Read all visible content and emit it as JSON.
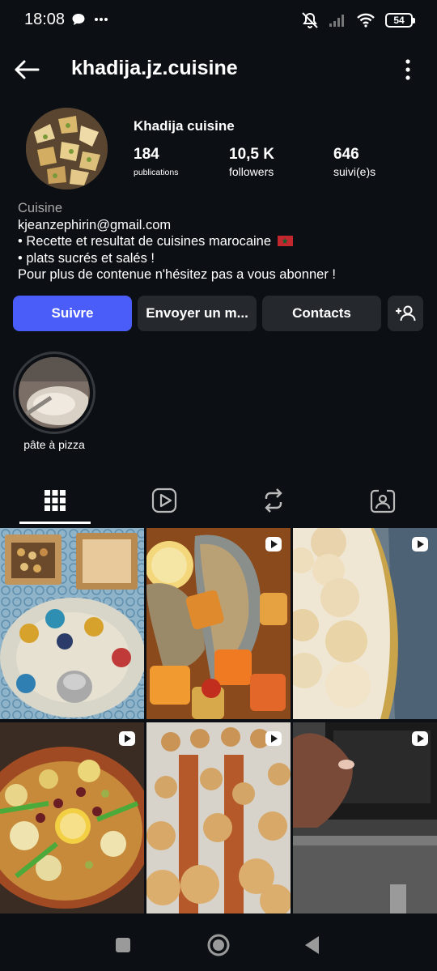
{
  "status_bar": {
    "time": "18:08",
    "battery": "54",
    "icons": [
      "chat-bubble-icon",
      "more-dots-icon",
      "mute-icon",
      "signal-icon",
      "wifi-icon",
      "battery-icon"
    ]
  },
  "header": {
    "username": "khadija.jz.cuisine"
  },
  "profile": {
    "display_name": "Khadija cuisine",
    "stats": {
      "posts": {
        "value": "184",
        "label": "publications"
      },
      "followers": {
        "value": "10,5 K",
        "label": "followers"
      },
      "following": {
        "value": "646",
        "label": "suivi(e)s"
      }
    },
    "bio": {
      "category": "Cuisine",
      "email": "kjeanzephirin@gmail.com",
      "line1": "• Recette et resultat de cuisines marocaine",
      "line2": "• plats sucrés et salés !",
      "line3": "Pour plus de contenue n'hésitez pas a vous abonner !"
    }
  },
  "actions": {
    "follow": "Suivre",
    "message": "Envoyer un m...",
    "contacts": "Contacts"
  },
  "highlights": [
    {
      "label": "pâte à pizza"
    }
  ],
  "tabs": [
    {
      "name": "grid-icon",
      "active": true
    },
    {
      "name": "reels-icon",
      "active": false
    },
    {
      "name": "reposts-icon",
      "active": false
    },
    {
      "name": "tagged-icon",
      "active": false
    }
  ],
  "colors": {
    "background": "#0c1014",
    "primary_button": "#4a5df9",
    "secondary_button": "#25292e",
    "muted_text": "#a8a8a8"
  },
  "grid": [
    {
      "subject": "moroccan tea tray with pastries",
      "reel": false
    },
    {
      "subject": "baked fish with vegetables",
      "reel": true
    },
    {
      "subject": "coconut cookies on gold tray",
      "reel": true
    },
    {
      "subject": "tajine with olives and lemon",
      "reel": true
    },
    {
      "subject": "mini burgers on tray",
      "reel": true
    },
    {
      "subject": "hand over oven",
      "reel": true
    }
  ]
}
